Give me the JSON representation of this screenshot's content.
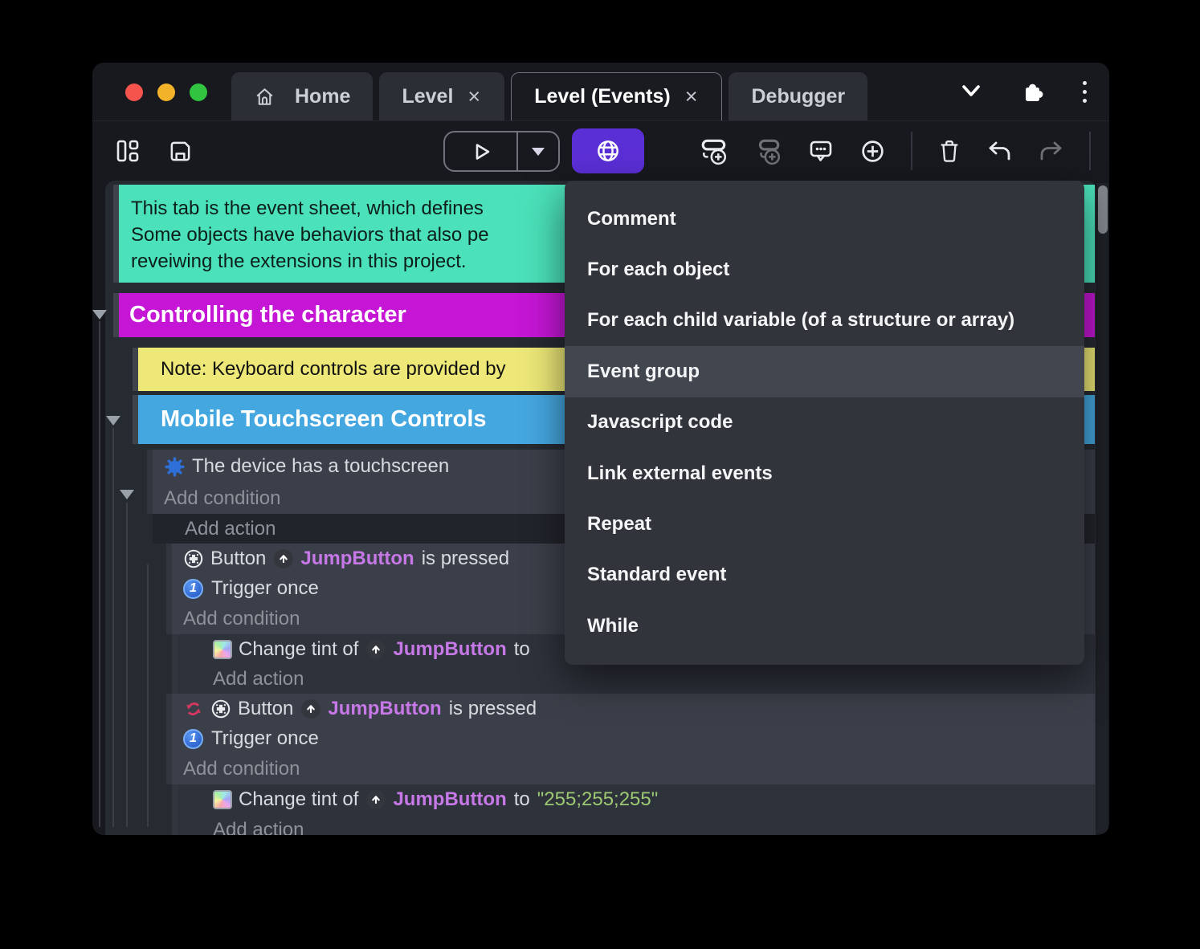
{
  "colors": {
    "accent_purple": "#5b2fd6",
    "comment_teal": "#4be1ba",
    "group_magenta": "#c516d6",
    "note_yellow": "#ede878",
    "group_blue": "#45a7e0",
    "object_name_purple": "#c678e6",
    "string_green": "#9dc973"
  },
  "titlebar": {
    "tabs": [
      {
        "label": "Home"
      },
      {
        "label": "Level"
      },
      {
        "label": "Level (Events)"
      },
      {
        "label": "Debugger"
      }
    ],
    "close_glyph": "×"
  },
  "menu": {
    "items": [
      "Comment",
      "For each object",
      "For each child variable (of a structure or array)",
      "Event group",
      "Javascript code",
      "Link external events",
      "Repeat",
      "Standard event",
      "While"
    ],
    "highlighted_item": "Event group"
  },
  "sheet": {
    "comment_line1": "This tab is the event sheet, which defines",
    "comment_line2": "Some objects have behaviors that also pe",
    "comment_line3": "reveiwing the extensions in this project.",
    "group_controlling": "Controlling the character",
    "note_keyboard": "Note: Keyboard controls are provided by",
    "group_mobile": "Mobile Touchscreen Controls",
    "device_condition": "The device has a touchscreen",
    "add_condition": "Add condition",
    "add_action": "Add action",
    "button_object": "Button",
    "jump_button": "JumpButton",
    "is_pressed": "is pressed",
    "trigger_once": "Trigger once",
    "trigger_once_badge": "1",
    "change_tint_of": "Change tint of",
    "to_word": "to",
    "tint_value": "\"255;255;255\""
  }
}
